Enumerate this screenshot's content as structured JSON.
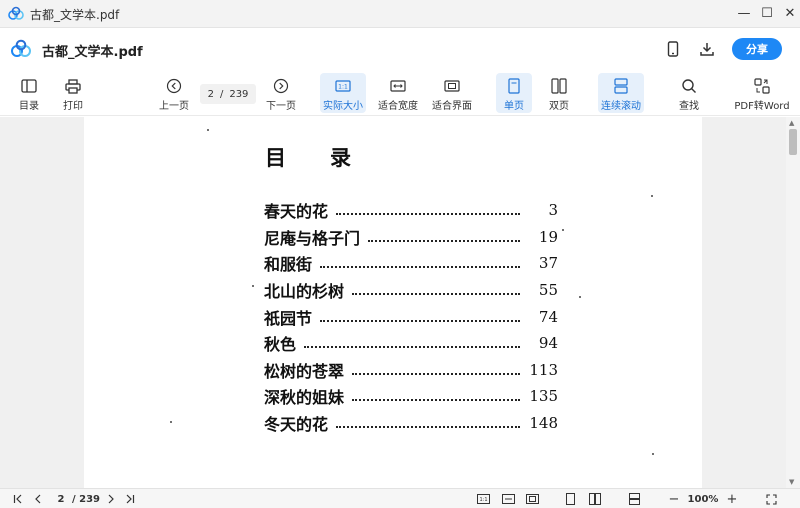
{
  "window": {
    "title": "古都_文学本.pdf",
    "minimize": "—",
    "maximize": "☐",
    "close": "✕"
  },
  "header": {
    "doc_title": "古都_文学本.pdf",
    "share_label": "分享",
    "icons": [
      "mobile-icon",
      "download-icon"
    ]
  },
  "toolbar": {
    "toc_label": "目录",
    "print_label": "打印",
    "prev_label": "上一页",
    "current_page": "2",
    "page_separator": "/",
    "total_pages": "239",
    "next_label": "下一页",
    "actual_size_label": "实际大小",
    "fit_width_label": "适合宽度",
    "fit_page_label": "适合界面",
    "single_label": "单页",
    "double_label": "双页",
    "continuous_label": "连续滚动",
    "search_label": "查找",
    "pdf2word_label": "PDF转Word"
  },
  "document": {
    "heading_char1": "目",
    "heading_char2": "录",
    "entries": [
      {
        "title": "春天的花",
        "page": "3"
      },
      {
        "title": "尼庵与格子门",
        "page": "19"
      },
      {
        "title": "和服街",
        "page": "37"
      },
      {
        "title": "北山的杉树",
        "page": "55"
      },
      {
        "title": "祇园节",
        "page": "74"
      },
      {
        "title": "秋色",
        "page": "94"
      },
      {
        "title": "松树的苍翠",
        "page": "113"
      },
      {
        "title": "深秋的姐妹",
        "page": "135"
      },
      {
        "title": "冬天的花",
        "page": "148"
      }
    ]
  },
  "statusbar": {
    "current_page": "2",
    "total_pages": "/ 239",
    "zoom": "100%",
    "zoom_out": "−",
    "zoom_in": "+"
  },
  "colors": {
    "accent": "#1e88f5",
    "active_bg": "#e6f0fb",
    "active_text": "#1e73d6"
  }
}
